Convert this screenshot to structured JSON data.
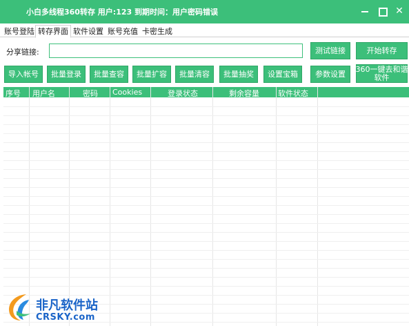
{
  "window": {
    "title": "小白多线程360转存 用户:123 到期时间：用户密码错误",
    "minimize_glyph": "",
    "maximize_glyph": "",
    "close_glyph": "✕"
  },
  "tabs": [
    {
      "label": "账号登陆",
      "active": false
    },
    {
      "label": "转存界面",
      "active": true
    },
    {
      "label": "软件设置",
      "active": false
    },
    {
      "label": "账号充值",
      "active": false
    },
    {
      "label": "卡密生成",
      "active": false
    }
  ],
  "share": {
    "label": "分享链接:",
    "value": ""
  },
  "buttons": {
    "test_link": "测试链接",
    "start_transfer": "开始转存",
    "import_account": "导入帐号",
    "batch_login": "批量登录",
    "batch_check": "批量查容",
    "batch_expand": "批量扩容",
    "batch_clear": "批量清容",
    "batch_lottery": "批量抽奖",
    "set_safebox": "设置宝箱",
    "param_settings": "参数设置",
    "one_key_line1": "360一键去和谐",
    "one_key_line2": "软件"
  },
  "table": {
    "columns": [
      "序号",
      "用户名",
      "密码",
      "Cookies",
      "登录状态",
      "剩余容量",
      "软件状态"
    ],
    "rows": []
  },
  "watermark": {
    "line1": "非凡软件站",
    "line2": "CRSKY.com",
    "logo_icon": "crsky-logo-icon"
  },
  "colors": {
    "accent": "#3cbf7a",
    "watermark": "#1a64c8"
  }
}
